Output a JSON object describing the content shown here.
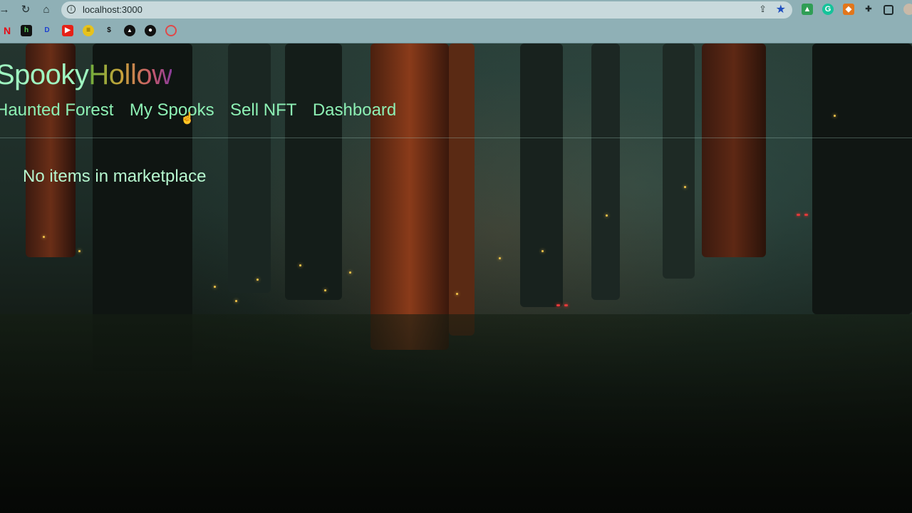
{
  "browser": {
    "url": "localhost:3000",
    "nav_icons": [
      "back-arrow-icon",
      "reload-icon",
      "home-icon"
    ],
    "extension_icons": [
      "google-drive-icon",
      "grammarly-icon",
      "metamask-icon",
      "extensions-puzzle-icon",
      "side-panel-icon",
      "profile-avatar"
    ],
    "bookmark_icons": [
      "netflix-icon",
      "h-icon",
      "d-icon",
      "youtube-icon",
      "coin-icon",
      "money-bag-icon",
      "triangle-icon",
      "github-icon",
      "target-icon"
    ]
  },
  "site": {
    "logo_part1": "Spooky",
    "logo_part2": "Hollow",
    "nav": {
      "haunted_forest": "Haunted Forest",
      "my_spooks": "My Spooks",
      "sell_nft": "Sell NFT",
      "dashboard": "Dashboard"
    },
    "empty_message": "No items in marketplace"
  },
  "colors": {
    "nav_text": "#8df0b4",
    "message_text": "#b6f7cf",
    "browser_chrome": "#8fb0b6"
  }
}
